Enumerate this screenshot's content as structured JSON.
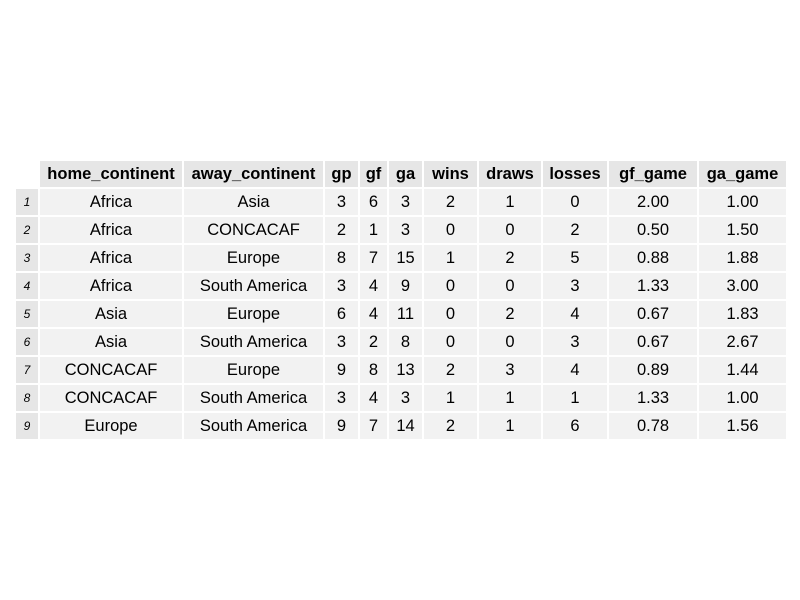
{
  "chart_data": {
    "type": "table",
    "columns": [
      "home_continent",
      "away_continent",
      "gp",
      "gf",
      "ga",
      "wins",
      "draws",
      "losses",
      "gf_game",
      "ga_game"
    ],
    "row_labels": [
      "1",
      "2",
      "3",
      "4",
      "5",
      "6",
      "7",
      "8",
      "9"
    ],
    "rows": [
      [
        "Africa",
        "Asia",
        "3",
        "6",
        "3",
        "2",
        "1",
        "0",
        "2.00",
        "1.00"
      ],
      [
        "Africa",
        "CONCACAF",
        "2",
        "1",
        "3",
        "0",
        "0",
        "2",
        "0.50",
        "1.50"
      ],
      [
        "Africa",
        "Europe",
        "8",
        "7",
        "15",
        "1",
        "2",
        "5",
        "0.88",
        "1.88"
      ],
      [
        "Africa",
        "South America",
        "3",
        "4",
        "9",
        "0",
        "0",
        "3",
        "1.33",
        "3.00"
      ],
      [
        "Asia",
        "Europe",
        "6",
        "4",
        "11",
        "0",
        "2",
        "4",
        "0.67",
        "1.83"
      ],
      [
        "Asia",
        "South America",
        "3",
        "2",
        "8",
        "0",
        "0",
        "3",
        "0.67",
        "2.67"
      ],
      [
        "CONCACAF",
        "Europe",
        "9",
        "8",
        "13",
        "2",
        "3",
        "4",
        "0.89",
        "1.44"
      ],
      [
        "CONCACAF",
        "South America",
        "3",
        "4",
        "3",
        "1",
        "1",
        "1",
        "1.33",
        "1.00"
      ],
      [
        "Europe",
        "South America",
        "9",
        "7",
        "14",
        "2",
        "1",
        "6",
        "0.78",
        "1.56"
      ]
    ]
  }
}
